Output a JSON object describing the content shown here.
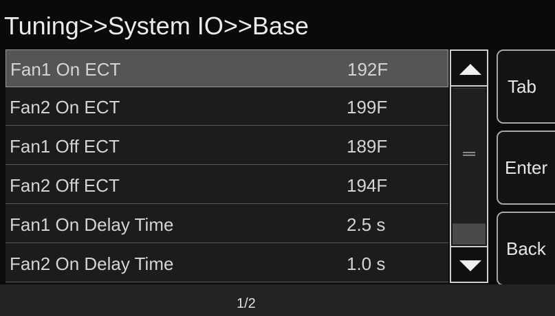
{
  "header": {
    "title": "Tuning>>System IO>>Base"
  },
  "list": {
    "selected_index": 0,
    "rows": [
      {
        "label": "Fan1 On ECT",
        "value": "192F"
      },
      {
        "label": "Fan2 On ECT",
        "value": "199F"
      },
      {
        "label": "Fan1 Off ECT",
        "value": "189F"
      },
      {
        "label": "Fan2 Off ECT",
        "value": "194F"
      },
      {
        "label": "Fan1 On Delay Time",
        "value": "2.5 s"
      },
      {
        "label": "Fan2 On Delay Time",
        "value": "1.0 s"
      }
    ]
  },
  "scrollbar": {
    "up_icon": "triangle-up-icon",
    "down_icon": "triangle-down-icon"
  },
  "side_buttons": {
    "tab_label": "Tab",
    "enter_label": "Enter",
    "back_label": "Back"
  },
  "footer": {
    "page_indicator": "1/2"
  }
}
